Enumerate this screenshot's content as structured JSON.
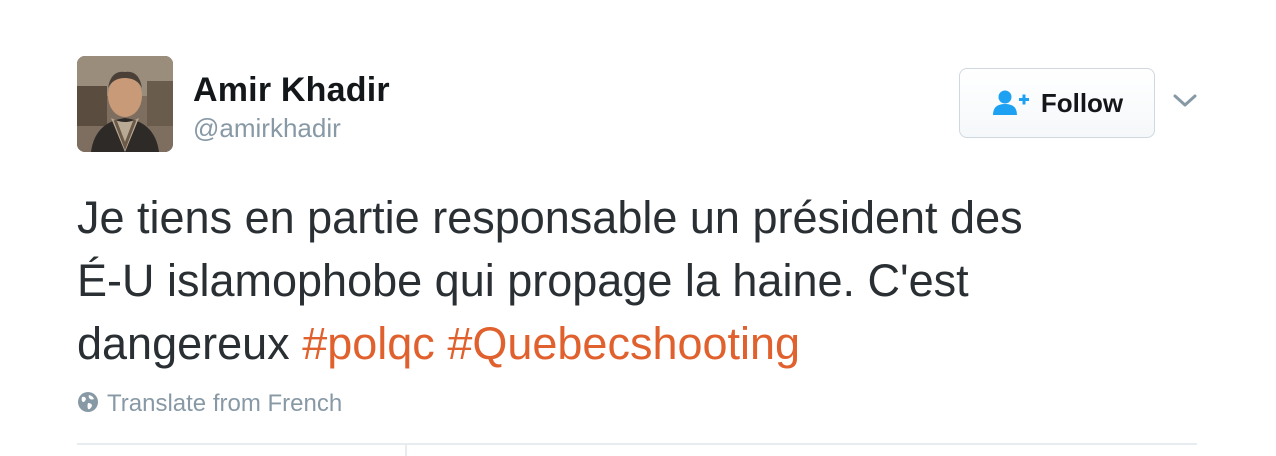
{
  "user": {
    "display_name": "Amir Khadir",
    "screen_name": "@amirkhadir"
  },
  "follow_button": {
    "label": "Follow",
    "icon": "follow-person-plus-icon"
  },
  "menu": {
    "icon": "chevron-down-icon"
  },
  "tweet": {
    "text_line1": "Je tiens en partie responsable un président des",
    "text_line2": "É-U islamophobe qui propage la haine. C'est",
    "text_line3_prefix": "dangereux ",
    "hashtags": [
      "#polqc",
      "#Quebecshooting"
    ]
  },
  "translate": {
    "label": "Translate from French",
    "icon": "globe-icon"
  },
  "colors": {
    "hashtag": "#e0612e",
    "follow_icon": "#1da1f2",
    "secondary_text": "#8899a6"
  }
}
